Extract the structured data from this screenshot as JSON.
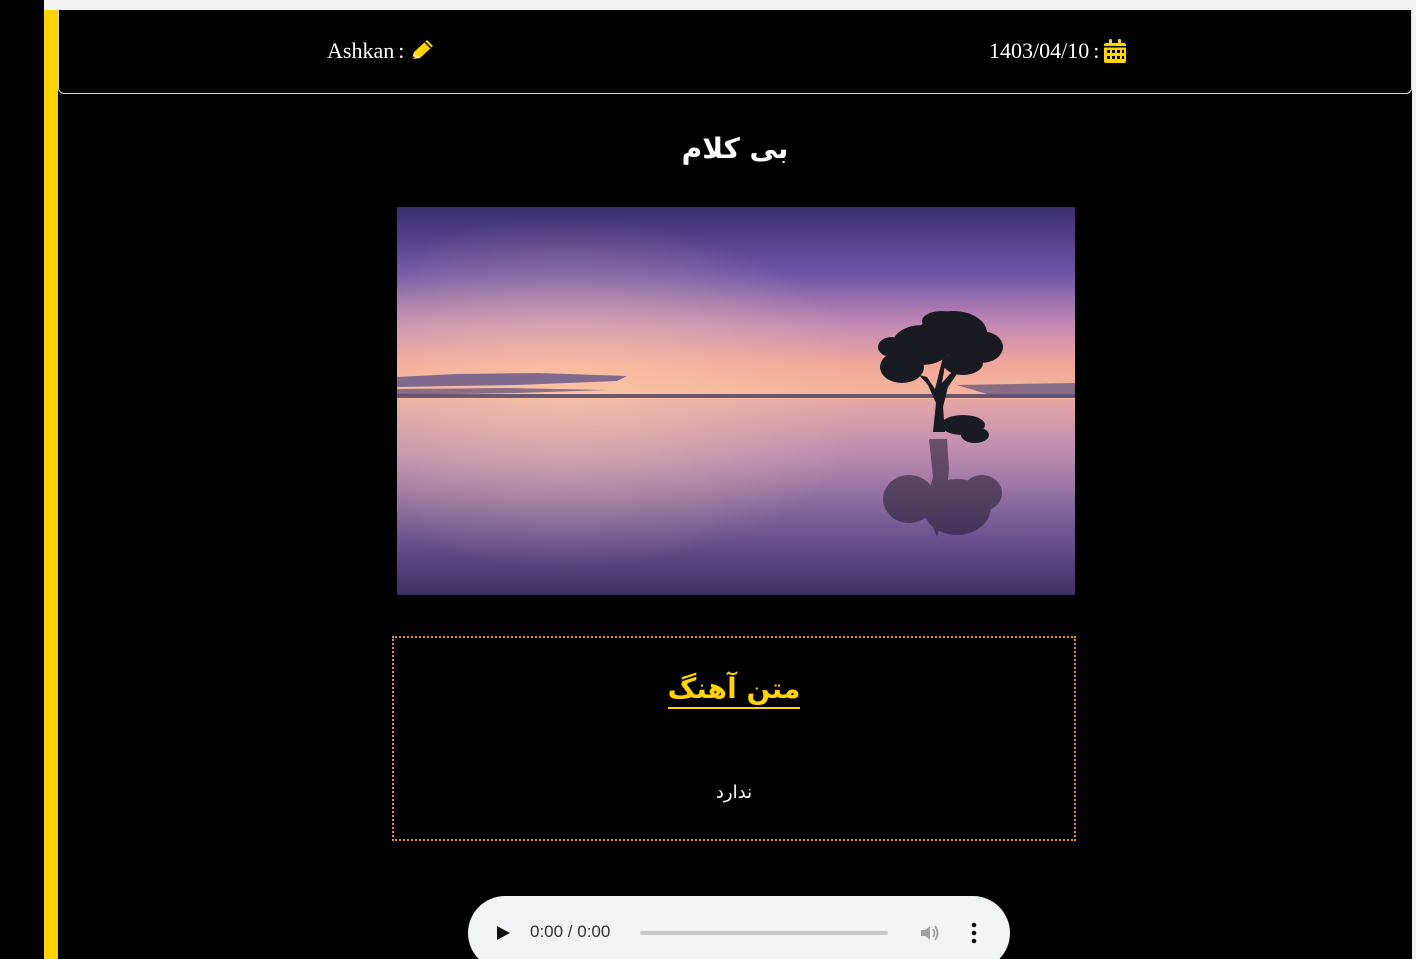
{
  "header": {
    "author_label": "Ashkan",
    "author_separator": ":",
    "author_icon": "pencil-icon",
    "date_label": "1403/04/10",
    "date_separator": ":",
    "date_icon": "calendar-icon"
  },
  "post": {
    "title": "بی کلام"
  },
  "cover": {
    "subject": "lake-sunset-tree"
  },
  "lyrics": {
    "heading": "متن آهنگ",
    "body": "ندارد"
  },
  "audio_player": {
    "time_display": "0:00 / 0:00",
    "progress": 0,
    "play_icon": "play-icon",
    "volume_icon": "volume-icon",
    "menu_icon": "more-vertical-icon"
  },
  "colors": {
    "accent": "#ffd400",
    "background": "#000000",
    "lyrics_border": "#e6952a",
    "text": "#ffffff"
  }
}
